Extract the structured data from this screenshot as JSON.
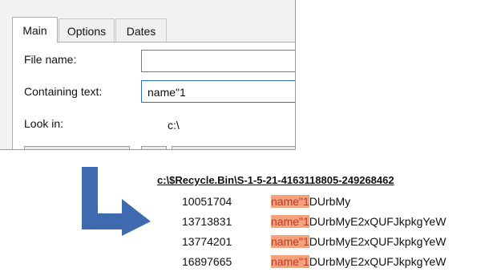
{
  "dialog": {
    "tabs": [
      "Main",
      "Options",
      "Dates"
    ],
    "file_name_label": "File name:",
    "file_name_value": "",
    "containing_text_label": "Containing text:",
    "containing_text_value": "name\"1",
    "look_in_label": "Look in:",
    "look_in_value": "c:\\"
  },
  "results": {
    "path": "c:\\$Recycle.Bin\\S-1-5-21-4163118805-249268462",
    "rows": [
      {
        "offset": "10051704",
        "match": "name\"1",
        "rest": "DUrbMy"
      },
      {
        "offset": "13713831",
        "match": "name\"1",
        "rest": "DUrbMyE2xQUFJkpkgYeW"
      },
      {
        "offset": "13774201",
        "match": "name\"1",
        "rest": "DUrbMyE2xQUFJkpkgYeW"
      },
      {
        "offset": "16897665",
        "match": "name\"1",
        "rest": "DUrbMyE2xQUFJkpkgYeW"
      }
    ]
  },
  "colors": {
    "arrow": "#3f6ab0",
    "highlight_bg": "#f4a27c",
    "highlight_text": "#c0392b",
    "focus_border": "#2b6cc4"
  }
}
